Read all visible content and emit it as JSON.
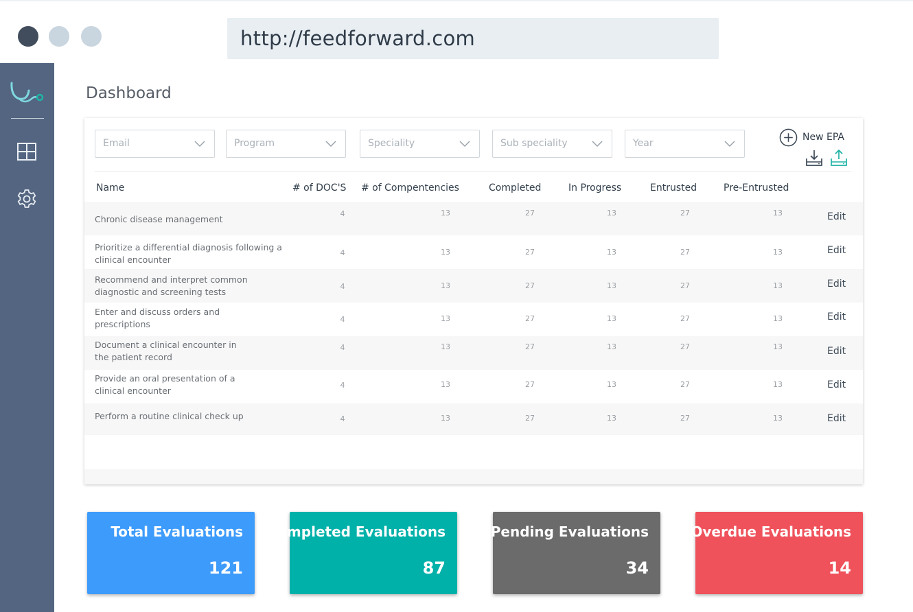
{
  "browser": {
    "url": "http://feedforward.com"
  },
  "sidebar": {
    "logo_icon": "stethoscope-logo-icon",
    "items": [
      {
        "name": "dashboard",
        "icon": "grid-icon"
      },
      {
        "name": "settings",
        "icon": "gear-icon"
      }
    ]
  },
  "page": {
    "title": "Dashboard"
  },
  "filters": [
    {
      "placeholder": "Email"
    },
    {
      "placeholder": "Program"
    },
    {
      "placeholder": "Speciality"
    },
    {
      "placeholder": "Sub speciality"
    },
    {
      "placeholder": "Year"
    }
  ],
  "actions": {
    "new_epa_label": "New EPA",
    "download_icon": "download-icon",
    "upload_icon": "upload-icon"
  },
  "table": {
    "headers": [
      "Name",
      "# of DOC'S",
      "# of Compentencies",
      "Completed",
      "In Progress",
      "Entrusted",
      "Pre-Entrusted"
    ],
    "edit_label": "Edit",
    "rows": [
      {
        "name": "Chronic disease management",
        "docs": "4",
        "competencies": "13",
        "completed": "27",
        "in_progress": "13",
        "entrusted": "27",
        "pre_entrusted": "13"
      },
      {
        "name": "Prioritize a differential diagnosis following a clinical encounter",
        "docs": "4",
        "competencies": "13",
        "completed": "27",
        "in_progress": "13",
        "entrusted": "27",
        "pre_entrusted": "13"
      },
      {
        "name": "Recommend and interpret common diagnostic and screening tests",
        "docs": "4",
        "competencies": "13",
        "completed": "27",
        "in_progress": "13",
        "entrusted": "27",
        "pre_entrusted": "13"
      },
      {
        "name": "Enter and discuss orders and prescriptions",
        "docs": "4",
        "competencies": "13",
        "completed": "27",
        "in_progress": "13",
        "entrusted": "27",
        "pre_entrusted": "13"
      },
      {
        "name": "Document a clinical encounter in the patient record",
        "docs": "4",
        "competencies": "13",
        "completed": "27",
        "in_progress": "13",
        "entrusted": "27",
        "pre_entrusted": "13"
      },
      {
        "name": "Provide an oral presentation of a clinical encounter",
        "docs": "4",
        "competencies": "13",
        "completed": "27",
        "in_progress": "13",
        "entrusted": "27",
        "pre_entrusted": "13"
      },
      {
        "name": "Perform a routine clinical check up",
        "docs": "4",
        "competencies": "13",
        "completed": "27",
        "in_progress": "13",
        "entrusted": "27",
        "pre_entrusted": "13"
      }
    ]
  },
  "stats": [
    {
      "title": "Total Evaluations",
      "value": "121",
      "color": "#3d9bfb"
    },
    {
      "title": "Completed Evaluations",
      "value": "87",
      "color": "#00b1a9"
    },
    {
      "title": "Pending Evaluations",
      "value": "34",
      "color": "#6b6b6b"
    },
    {
      "title": "Overdue Evaluations",
      "value": "14",
      "color": "#ef525b"
    }
  ],
  "colors": {
    "sidebar": "#536580",
    "accent_teal": "#1fb3a6"
  }
}
